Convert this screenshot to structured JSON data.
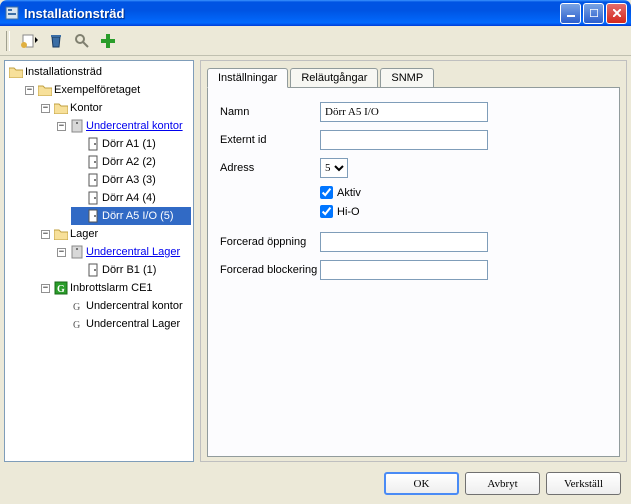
{
  "window": {
    "title": "Installationsträd"
  },
  "tree": {
    "root": "Installationsträd",
    "company": "Exempelföretaget",
    "group1": "Kontor",
    "uc_kontor": "Undercentral kontor",
    "doors": {
      "a1": "Dörr A1 (1)",
      "a2": "Dörr A2 (2)",
      "a3": "Dörr A3 (3)",
      "a4": "Dörr A4 (4)",
      "a5": "Dörr A5 I/O (5)"
    },
    "group2": "Lager",
    "uc_lager": "Undercentral Lager",
    "door_b1": "Dörr B1 (1)",
    "alarm": "Inbrottslarm CE1",
    "alarm_uc1": "Undercentral kontor",
    "alarm_uc2": "Undercentral Lager"
  },
  "tabs": {
    "settings": "Inställningar",
    "relays": "Reläutgångar",
    "snmp": "SNMP"
  },
  "form": {
    "name_label": "Namn",
    "name_value": "Dörr A5 I/O",
    "extid_label": "Externt id",
    "extid_value": "",
    "addr_label": "Adress",
    "addr_value": "5",
    "aktiv": "Aktiv",
    "hio": "Hi-O",
    "forced_open": "Forcerad öppning",
    "forced_open_value": "",
    "forced_block": "Forcerad blockering",
    "forced_block_value": ""
  },
  "buttons": {
    "ok": "OK",
    "cancel": "Avbryt",
    "apply": "Verkställ"
  }
}
